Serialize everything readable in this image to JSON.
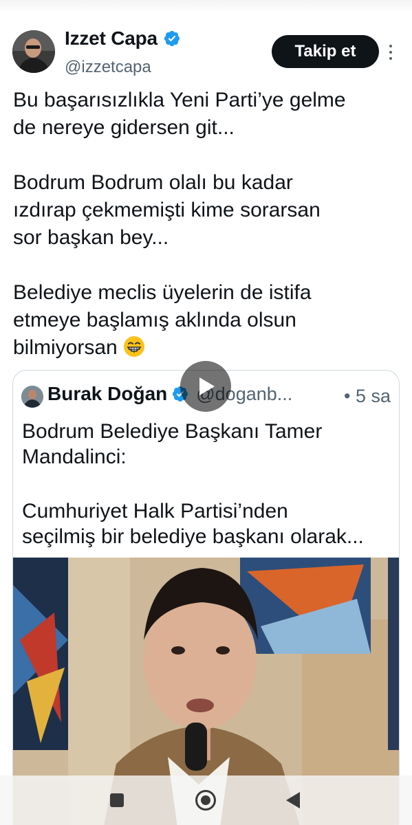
{
  "author": {
    "display_name": "Izzet Capa",
    "handle": "@izzetcapa",
    "verified": true
  },
  "follow_button": {
    "label": "Takip et"
  },
  "tweet": {
    "lines_p1": [
      "Bu başarısızlıkla Yeni Parti’ye gelme",
      "de nereye gidersen git..."
    ],
    "lines_p2": [
      "Bodrum Bodrum olalı bu kadar",
      "ızdırap çekmemişti kime sorarsan",
      "sor başkan bey..."
    ],
    "lines_p3": [
      "Belediye meclis üyelerin de istifa",
      "etmeye başlamış aklında olsun",
      "bilmiyorsan"
    ],
    "trailing_emoji": "grinning-face-emoji"
  },
  "quoted_tweet": {
    "display_name": "Burak Doğan",
    "handle": "@doganb...",
    "time": "• 5 sa",
    "verified": true,
    "lines_p1": [
      "Bodrum Belediye Başkanı Tamer",
      "Mandalinci:"
    ],
    "lines_p2": [
      "Cumhuriyet Halk Partisi’nden",
      "seçilmiş bir belediye başkanı olarak..."
    ],
    "media": {
      "type": "video",
      "icon": "play-icon"
    }
  },
  "colors": {
    "verified_blue": "#1d9bf0",
    "text_primary": "#0f1419",
    "text_secondary": "#536471",
    "border": "#cfd9de",
    "follow_bg": "#0f1419"
  },
  "system_nav": {
    "icons": [
      "recent-apps-icon",
      "home-icon",
      "back-icon"
    ]
  }
}
